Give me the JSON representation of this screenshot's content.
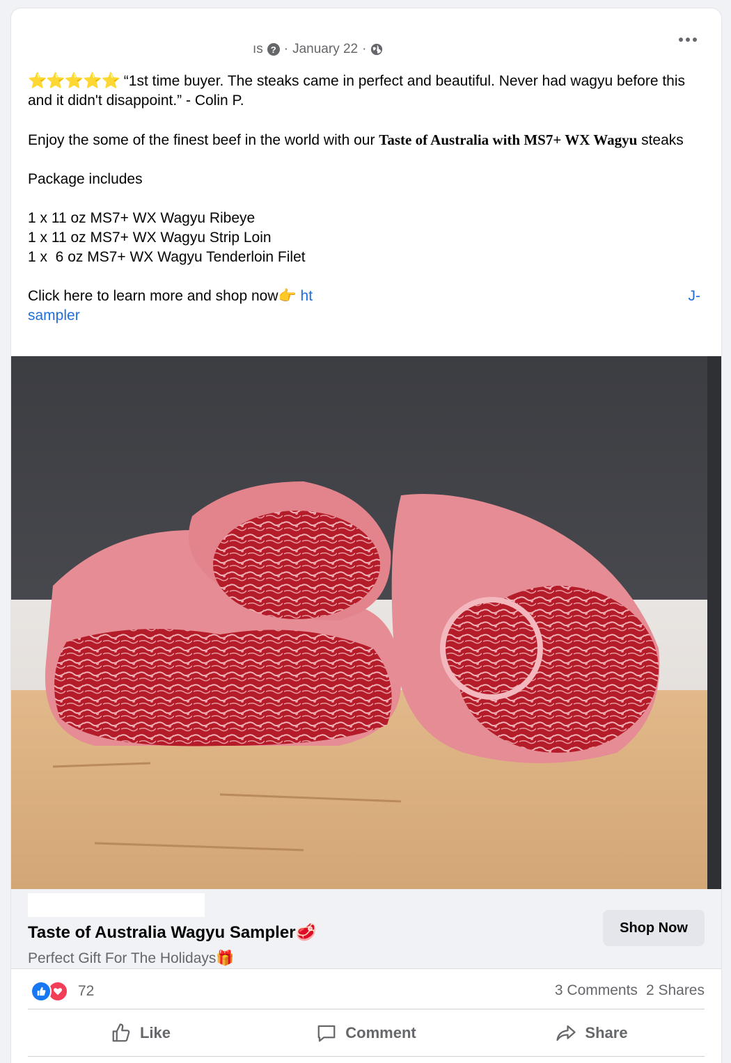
{
  "post": {
    "author_suffix": "ıs",
    "date": "January 22",
    "separator": "·",
    "privacy_icon": "globe-icon",
    "more_icon": "more-options-icon"
  },
  "body": {
    "stars": "⭐⭐⭐⭐⭐",
    "quote": " “1st time buyer. The steaks came in perfect and beautiful. Never had wagyu before this and it didn't disappoint.” - Colin P.",
    "intro_prefix": "Enjoy the some of the finest beef in the world with our ",
    "intro_product": "Taste of Australia with MS7+ WX Wagyu",
    "intro_suffix": " steaks",
    "package_heading": "Package includes",
    "items": [
      "1 x 11 oz MS7+ WX Wagyu Ribeye",
      "1 x 11 oz MS7+ WX Wagyu Strip Loin",
      "1 x  6 oz MS7+ WX Wagyu Tenderloin Filet"
    ],
    "cta_text": "Click here to learn more and shop now👉 ",
    "link_start": "ht",
    "link_tail": "J-",
    "link_end": "sampler"
  },
  "ad": {
    "title": "Taste of Australia Wagyu Sampler🥩",
    "subtitle": "Perfect Gift For The Holidays🎁",
    "button": "Shop Now"
  },
  "stats": {
    "reaction_count": "72",
    "comments": "3 Comments",
    "shares": "2 Shares"
  },
  "actions": {
    "like": "Like",
    "comment": "Comment",
    "share": "Share"
  },
  "colors": {
    "link": "#216fdb",
    "like_blue": "#1877f2",
    "love_red": "#f33e58",
    "muted": "#65676b"
  }
}
